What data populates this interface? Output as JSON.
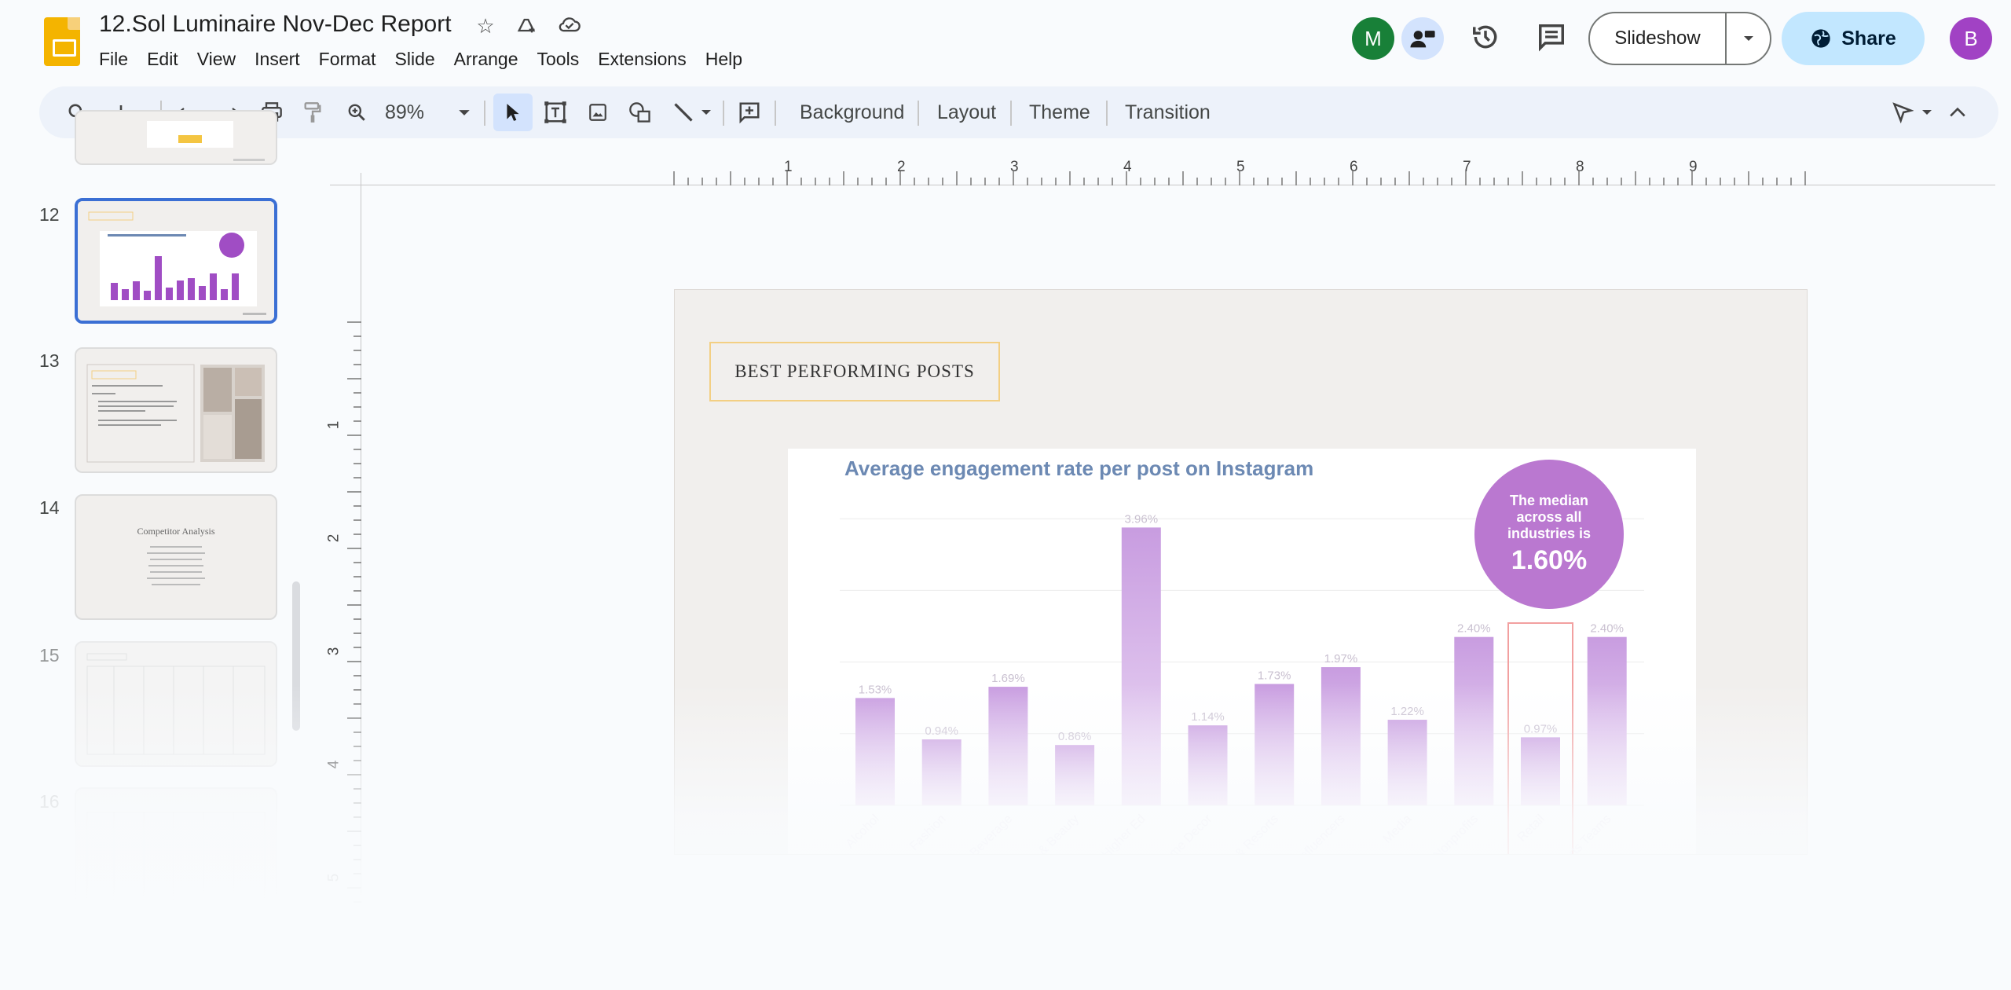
{
  "doc": {
    "title": "12.Sol Luminaire Nov-Dec Report"
  },
  "menu": [
    "File",
    "Edit",
    "View",
    "Insert",
    "Format",
    "Slide",
    "Arrange",
    "Tools",
    "Extensions",
    "Help"
  ],
  "header": {
    "avatar_m": "M",
    "avatar_b": "B",
    "slideshow_label": "Slideshow",
    "share_label": "Share"
  },
  "toolbar": {
    "zoom": "89%",
    "background_label": "Background",
    "layout_label": "Layout",
    "theme_label": "Theme",
    "transition_label": "Transition"
  },
  "filmstrip": {
    "slides": [
      {
        "num": "12",
        "selected": true
      },
      {
        "num": "13",
        "selected": false
      },
      {
        "num": "14",
        "selected": false,
        "caption": "Competitor Analysis"
      },
      {
        "num": "15",
        "selected": false
      },
      {
        "num": "16",
        "selected": false
      }
    ]
  },
  "rulers": {
    "horizontal": [
      "1",
      "2",
      "3",
      "4",
      "5",
      "6",
      "7",
      "8",
      "9"
    ],
    "vertical": [
      "1",
      "2",
      "3",
      "4",
      "5"
    ]
  },
  "slide": {
    "label": "BEST PERFORMING POSTS",
    "median": {
      "text": "The median across all industries is",
      "value": "1.60%"
    }
  },
  "chart_data": {
    "type": "bar",
    "title": "Average engagement rate per post on Instagram",
    "categories": [
      "Alcohol",
      "Fashion",
      "Food & Beverage",
      "Health & Beauty",
      "Higher Ed",
      "Home Decor",
      "Hotels & Resorts",
      "Influencers",
      "Media",
      "Nonprofits",
      "Retail",
      "Sports Teams"
    ],
    "values": [
      1.53,
      0.94,
      1.69,
      0.86,
      3.96,
      1.14,
      1.73,
      1.97,
      1.22,
      2.4,
      0.97,
      2.4
    ],
    "value_labels": [
      "1.53%",
      "0.94%",
      "1.69%",
      "0.86%",
      "3.96%",
      "1.14%",
      "1.73%",
      "1.97%",
      "1.22%",
      "2.40%",
      "0.97%",
      "2.40%"
    ],
    "highlighted_category": "Retail",
    "ylim": [
      0,
      4
    ],
    "grid": true,
    "colors": {
      "bar_top": "#c89ce0",
      "bar_bottom": "#eddcf6",
      "highlight_outline": "#f2a0a0",
      "title": "#6c89b3",
      "median_circle": "#ba78d0"
    }
  },
  "colors": {
    "accent_blue": "#0b57d0",
    "share_bg": "#c2e7ff",
    "avatar_m": "#188038",
    "avatar_b": "#a142c4"
  }
}
